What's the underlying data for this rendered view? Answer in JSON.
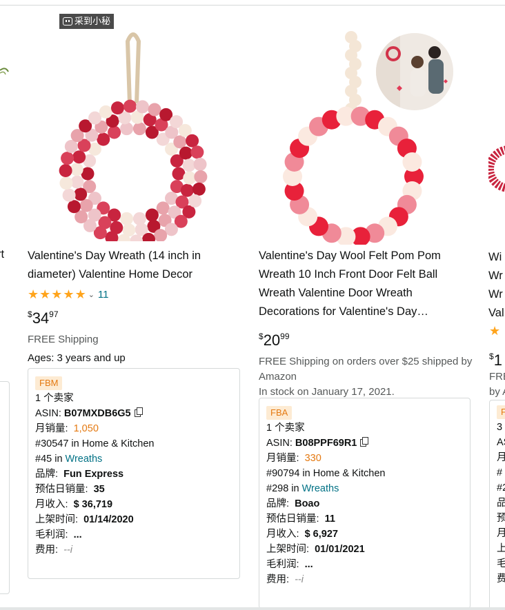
{
  "top_badge": {
    "label": "采到小秘",
    "icon": "robot-icon"
  },
  "left_partial": {
    "text_fragment": "rt"
  },
  "product1": {
    "title": "Valentine's Day Wreath (14 inch in diameter) Valentine Home Decor",
    "rating_stars": 5,
    "review_count": "11",
    "price_symbol": "$",
    "price_whole": "34",
    "price_fraction": "97",
    "shipping": "FREE Shipping",
    "ages": "Ages: 3 years and up",
    "ext": {
      "tag": "FBM",
      "sellers": "1 个卖家",
      "asin_label": "ASIN:",
      "asin": "B07MXDB6G5",
      "monthly_sales_label": "月销量:",
      "monthly_sales": "1,050",
      "rank1": "#30547 in Home & Kitchen",
      "rank2_prefix": "#45 in",
      "rank2_link": "Wreaths",
      "brand_label": "品牌:",
      "brand": "Fun Express",
      "daily_label": "预估日销量:",
      "daily": "35",
      "revenue_label": "月收入:",
      "revenue": "$ 36,719",
      "listed_label": "上架时间:",
      "listed": "01/14/2020",
      "margin_label": "毛利润:",
      "margin": "...",
      "fee_label": "费用:",
      "fee": "--i"
    }
  },
  "product2": {
    "title": "Valentine's Day Wool Felt Pom Pom Wreath 10 Inch Front Door Felt Ball Wreath Valentine Door Wreath Decorations for Valentine's Day…",
    "price_symbol": "$",
    "price_whole": "20",
    "price_fraction": "99",
    "shipping": "FREE Shipping on orders over $25 shipped by Amazon",
    "stock": "In stock on January 17, 2021.",
    "ext": {
      "tag": "FBA",
      "sellers": "1 个卖家",
      "asin_label": "ASIN:",
      "asin": "B08PPF69R1",
      "monthly_sales_label": "月销量:",
      "monthly_sales": "330",
      "rank1": "#90794 in Home & Kitchen",
      "rank2_prefix": "#298 in",
      "rank2_link": "Wreaths",
      "brand_label": "品牌:",
      "brand": "Boao",
      "daily_label": "预估日销量:",
      "daily": "11",
      "revenue_label": "月收入:",
      "revenue": "$ 6,927",
      "listed_label": "上架时间:",
      "listed": "01/01/2021",
      "margin_label": "毛利润:",
      "margin": "...",
      "fee_label": "费用:",
      "fee": "--i"
    }
  },
  "right_partial": {
    "title_lines": [
      "Wi",
      "Wr",
      "Wr",
      "Val"
    ],
    "price_symbol": "$",
    "price_whole": "1",
    "shipping_lines": [
      "FRE",
      "by A"
    ],
    "ext_tag": "F",
    "ext_lines": [
      "3",
      "AS",
      "月",
      "#",
      "#2",
      "品",
      "预",
      "月",
      "上",
      "毛",
      "费"
    ]
  }
}
